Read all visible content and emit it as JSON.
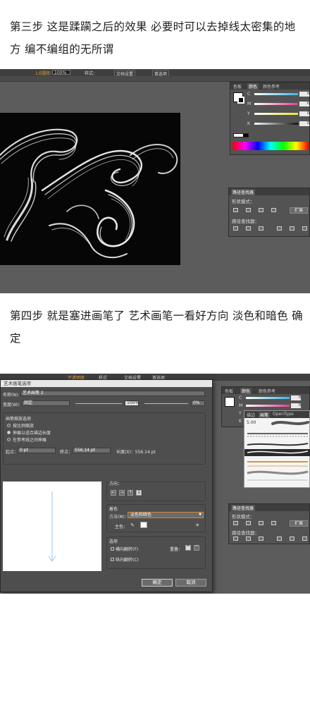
{
  "captions": {
    "step3": "第三步  这是蹂躏之后的效果 必要时可以去掉线太密集的地方 编不编组的无所谓",
    "step4": "第四步 就是塞进画笔了 艺术画笔一看好方向 淡色和暗色 确定"
  },
  "screenshot1": {
    "toolbar": {
      "brush_label": "1点圆形",
      "opacity_value": "100%",
      "style_label": "样式：",
      "doc_setup": "文档设置",
      "preferences": "首选项"
    },
    "color_panel": {
      "tabs": [
        "色板",
        "颜色",
        "颜色参考"
      ],
      "active_tab": "颜色",
      "channels": [
        {
          "label": "C",
          "color": "#37b7e8",
          "value": "0"
        },
        {
          "label": "M",
          "color": "#e8399a",
          "value": "0"
        },
        {
          "label": "Y",
          "color": "#e8e237",
          "value": "0"
        },
        {
          "label": "K",
          "color": "#222222",
          "value": "0"
        }
      ]
    },
    "pathfinder_panel": {
      "tab": "路径查找器",
      "shape_modes_label": "形状模式：",
      "expand_label": "扩展",
      "pathfinders_label": "路径查找器："
    }
  },
  "screenshot2": {
    "top_labels": [
      "不透明度",
      "样式",
      "文档设置",
      "首选项"
    ],
    "dialog": {
      "title": "艺术画笔选项",
      "name_label": "名称(N):",
      "name_value": "艺术画笔 2",
      "width_label": "宽度(W):",
      "width_value": "固定",
      "width_pct": "100%",
      "width_pct2": "0%",
      "scale_group_label": "画笔缩放选项",
      "scale_options": [
        "按比例缩放",
        "伸展以适合描边长度",
        "在参考线之间伸展"
      ],
      "scale_selected_index": 1,
      "start_label": "起点：",
      "start_value": "0 pt",
      "end_label": "终点：",
      "end_value": "556.14 pt",
      "length_label": "长度(X)：556.14 pt",
      "direction_label": "方向：",
      "directions": [
        "←",
        "→",
        "↑",
        "↓"
      ],
      "direction_selected": 3,
      "colorize_label": "着色",
      "method_label": "方法(M)：",
      "method_value": "淡色和暗色",
      "key_color_label": "主色：",
      "options_label": "选项",
      "flip_along": "横向翻转(F)",
      "flip_across": "纵向翻转(C)",
      "overlap_label": "重叠：",
      "ok": "确定",
      "cancel": "取消"
    },
    "color_panel": {
      "tabs": [
        "色板",
        "颜色",
        "颜色参考"
      ],
      "active_tab": "颜色",
      "channels": [
        {
          "label": "C",
          "color": "#37b7e8",
          "value": "0"
        },
        {
          "label": "M",
          "color": "#e8399a",
          "value": "0"
        },
        {
          "label": "Y",
          "color": "#e8e237",
          "value": "0"
        },
        {
          "label": "K",
          "color": "#222222",
          "value": "0"
        }
      ]
    },
    "brush_panel": {
      "tabs": [
        "描边",
        "画笔",
        "OpenType"
      ],
      "active_tab": "画笔",
      "size_value": "5.00"
    },
    "pathfinder_panel": {
      "tab": "路径查找器",
      "shape_modes_label": "形状模式：",
      "expand_label": "扩展",
      "pathfinders_label": "路径查找器："
    }
  }
}
